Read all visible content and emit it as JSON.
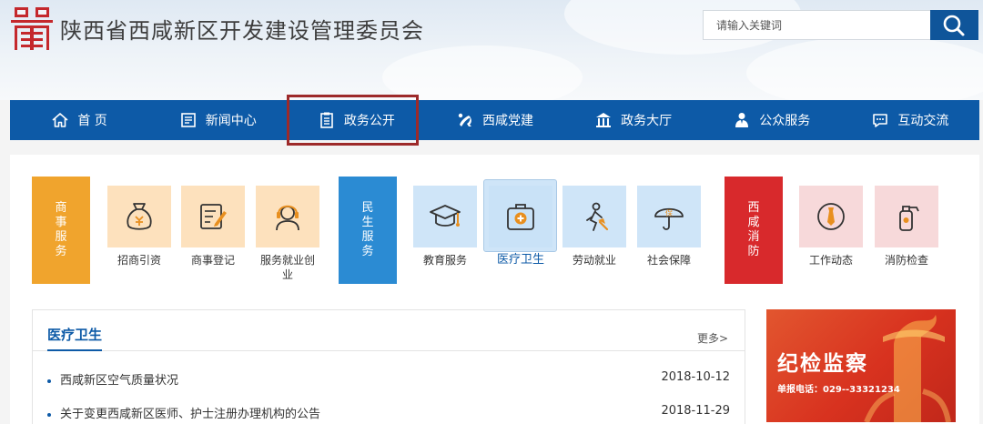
{
  "header": {
    "title": "陕西省西咸新区开发建设管理委员会",
    "search_placeholder": "请输入关键词"
  },
  "nav": {
    "items": [
      {
        "label": "首 页",
        "icon": "home-icon"
      },
      {
        "label": "新闻中心",
        "icon": "news-icon"
      },
      {
        "label": "政务公开",
        "icon": "clipboard-icon"
      },
      {
        "label": "西咸党建",
        "icon": "party-emblem-icon"
      },
      {
        "label": "政务大厅",
        "icon": "government-building-icon"
      },
      {
        "label": "公众服务",
        "icon": "person-service-icon"
      },
      {
        "label": "互动交流",
        "icon": "chat-bubble-icon"
      }
    ]
  },
  "categories": [
    {
      "label": "商事服务",
      "color": "#f0a42d"
    },
    {
      "label": "民生服务",
      "color": "#2b8bd3"
    },
    {
      "label": "西咸消防",
      "color": "#d8292c"
    }
  ],
  "tiles": {
    "business": [
      {
        "label": "招商引资",
        "icon": "money-bag-icon"
      },
      {
        "label": "商事登记",
        "icon": "edit-form-icon"
      },
      {
        "label": "服务就业创业",
        "icon": "headset-person-icon"
      }
    ],
    "livelihood": [
      {
        "label": "教育服务",
        "icon": "graduation-cap-icon"
      },
      {
        "label": "医疗卫生",
        "icon": "medical-kit-icon"
      },
      {
        "label": "劳动就业",
        "icon": "worker-icon"
      },
      {
        "label": "社会保障",
        "icon": "umbrella-icon"
      }
    ],
    "fire": [
      {
        "label": "工作动态",
        "icon": "tie-icon"
      },
      {
        "label": "消防检查",
        "icon": "fire-extinguisher-icon"
      }
    ]
  },
  "colors": {
    "nav_bg": "#0d5aa7",
    "business_tile_bg": "#fde1bd",
    "livelihood_tile_bg": "#cfe5f8",
    "fire_tile_bg": "#f7d9da"
  },
  "news": {
    "title": "医疗卫生",
    "more": "更多>",
    "items": [
      {
        "text": "西咸新区空气质量状况",
        "date": "2018-10-12"
      },
      {
        "text": "关于变更西咸新区医师、护士注册办理机构的公告",
        "date": "2018-11-29"
      }
    ]
  },
  "promo": {
    "title": "纪检监察",
    "phone": "单报电话：029--33321234"
  }
}
